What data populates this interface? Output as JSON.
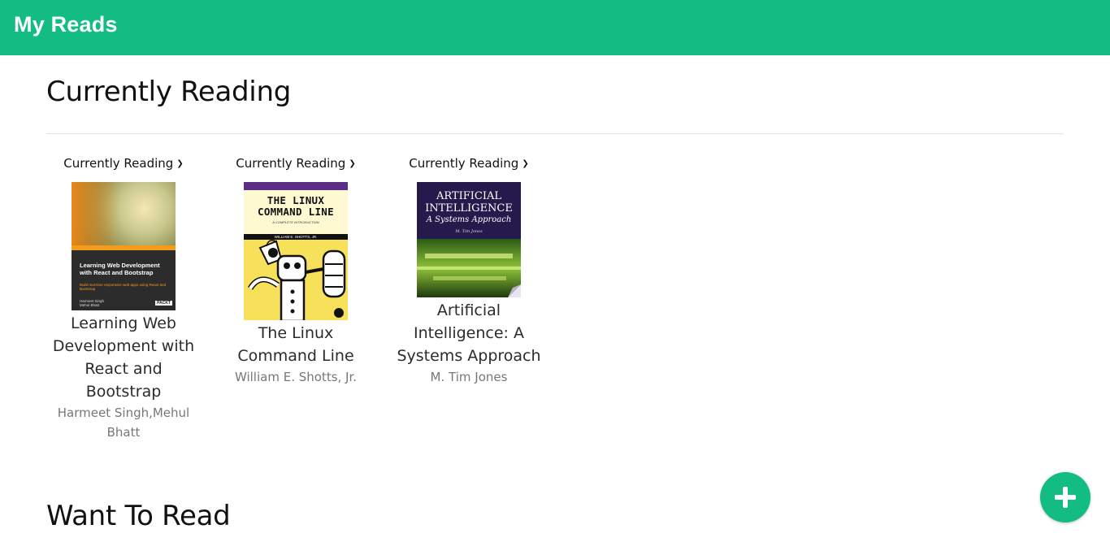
{
  "header": {
    "title": "My Reads"
  },
  "shelves": [
    {
      "title": "Currently Reading",
      "books": [
        {
          "shelf_select": "Currently Reading",
          "title": "Learning Web Development with React and Bootstrap",
          "authors": "Harmeet Singh,Mehul Bhatt",
          "cover": {
            "title": "Learning Web Development with React and Bootstrap",
            "subtitle": "Build real-time responsive web apps using React and Bootstrap",
            "authors": "Harmeet Singh\nMehul Bhatt",
            "publisher": "PACKT"
          }
        },
        {
          "shelf_select": "Currently Reading",
          "title": "The Linux Command Line",
          "authors": "William E. Shotts, Jr.",
          "cover": {
            "title": "THE LINUX COMMAND LINE",
            "subtitle": "A COMPLETE INTRODUCTION",
            "authors": "WILLIAM E. SHOTTS, JR."
          }
        },
        {
          "shelf_select": "Currently Reading",
          "title": "Artificial Intelligence: A Systems Approach",
          "authors": "M. Tim Jones",
          "cover": {
            "title": "ARTIFICIAL INTELLIGENCE",
            "subtitle": "A Systems Approach",
            "authors": "M. Tim Jones"
          }
        }
      ]
    },
    {
      "title": "Want To Read",
      "books": []
    }
  ],
  "fab": {
    "icon": "plus-icon"
  },
  "colors": {
    "accent": "#12bc82"
  }
}
